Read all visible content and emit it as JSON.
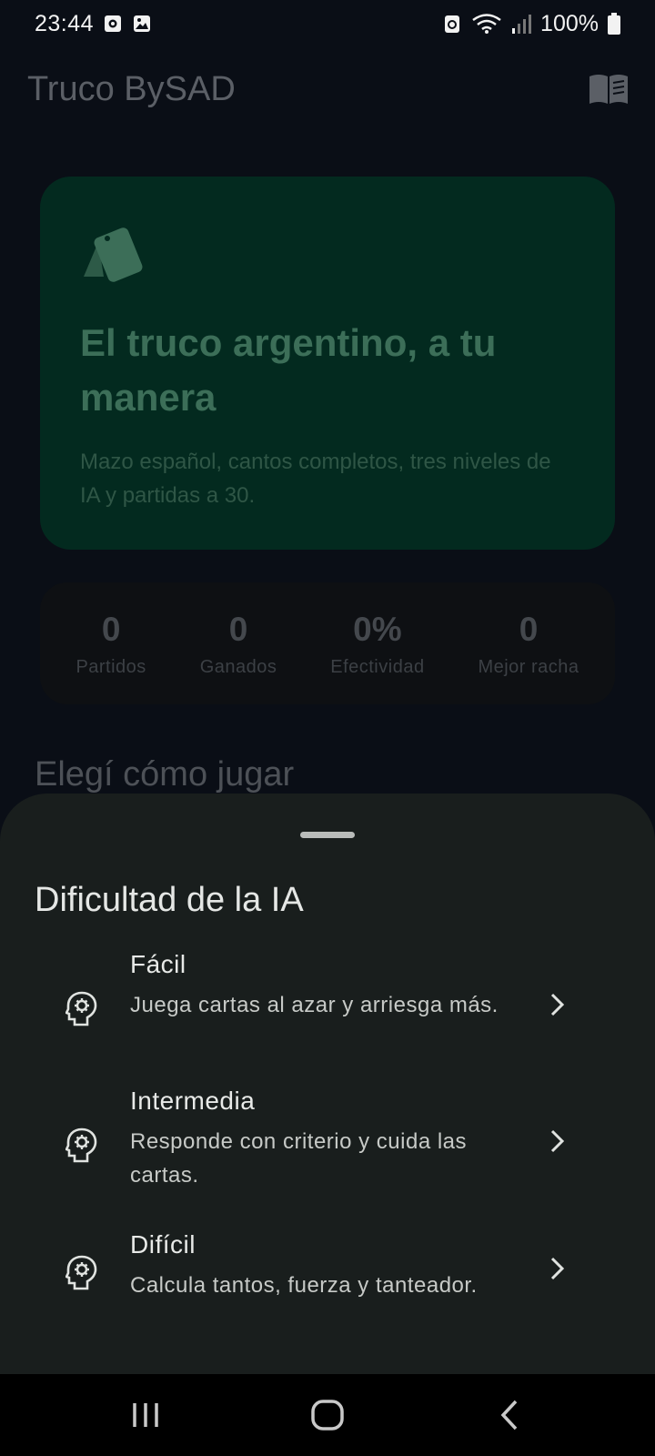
{
  "status_bar": {
    "time": "23:44",
    "battery": "100%"
  },
  "app_bar": {
    "title": "Truco BySAD",
    "action_icon": "book-icon"
  },
  "hero": {
    "title": "El truco argentino, a tu manera",
    "subtitle": "Mazo español, cantos completos, tres niveles de IA y partidas a 30."
  },
  "stats": [
    {
      "value": "0",
      "label": "Partidos"
    },
    {
      "value": "0",
      "label": "Ganados"
    },
    {
      "value": "0%",
      "label": "Efectividad"
    },
    {
      "value": "0",
      "label": "Mejor racha"
    }
  ],
  "section_title": "Elegí cómo jugar",
  "sheet": {
    "title": "Dificultad de la IA",
    "options": [
      {
        "title": "Fácil",
        "description": "Juega cartas al azar y arriesga más."
      },
      {
        "title": "Intermedia",
        "description": "Responde con criterio y cuida las cartas."
      },
      {
        "title": "Difícil",
        "description": "Calcula tantos, fuerza y tanteador."
      }
    ]
  },
  "colors": {
    "background": "#0a0e16",
    "hero_card": "#032a1f",
    "sheet": "#191e1d"
  }
}
